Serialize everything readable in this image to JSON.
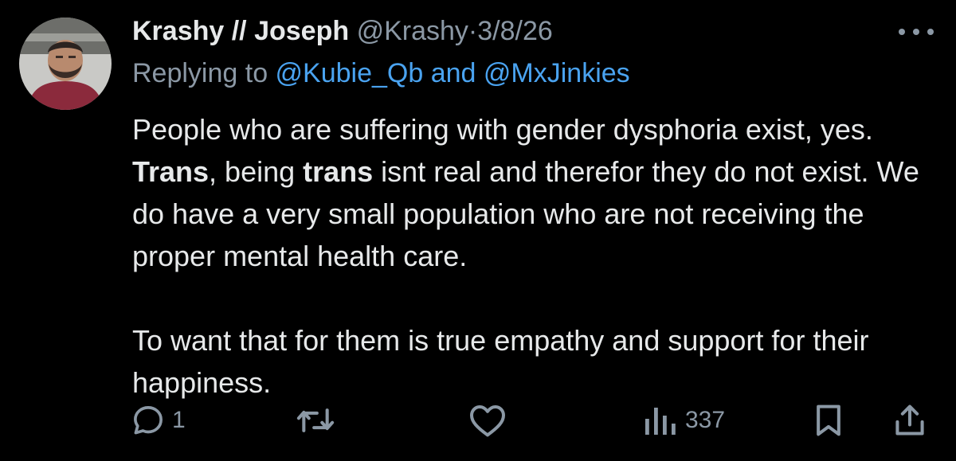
{
  "author": {
    "display_name": "Krashy // Joseph",
    "handle": "@Krashy",
    "separator": "·",
    "date": "3/8/26"
  },
  "replying": {
    "prefix": "Replying to ",
    "mentions": "@Kubie_Qb and @MxJinkies"
  },
  "tweet": {
    "p1_a": "People who are suffering with gender dysphoria exist, yes. ",
    "p1_b1": "Trans",
    "p1_c": ", being ",
    "p1_b2": "trans",
    "p1_d": " isnt real and therefor they do not exist. We do have a very small population who are not receiving the proper mental health care.",
    "p2": "To want that for them is true empathy and support for their happiness."
  },
  "actions": {
    "reply_count": "1",
    "views_count": "337"
  },
  "icons": {
    "more": "more-horizontal-icon",
    "reply": "reply-icon",
    "retweet": "retweet-icon",
    "like": "heart-icon",
    "views": "views-icon",
    "bookmark": "bookmark-icon",
    "share": "share-icon"
  },
  "colors": {
    "background": "#000000",
    "text": "#e7e9ea",
    "muted": "#8b98a5",
    "link": "#4aa3f0"
  }
}
